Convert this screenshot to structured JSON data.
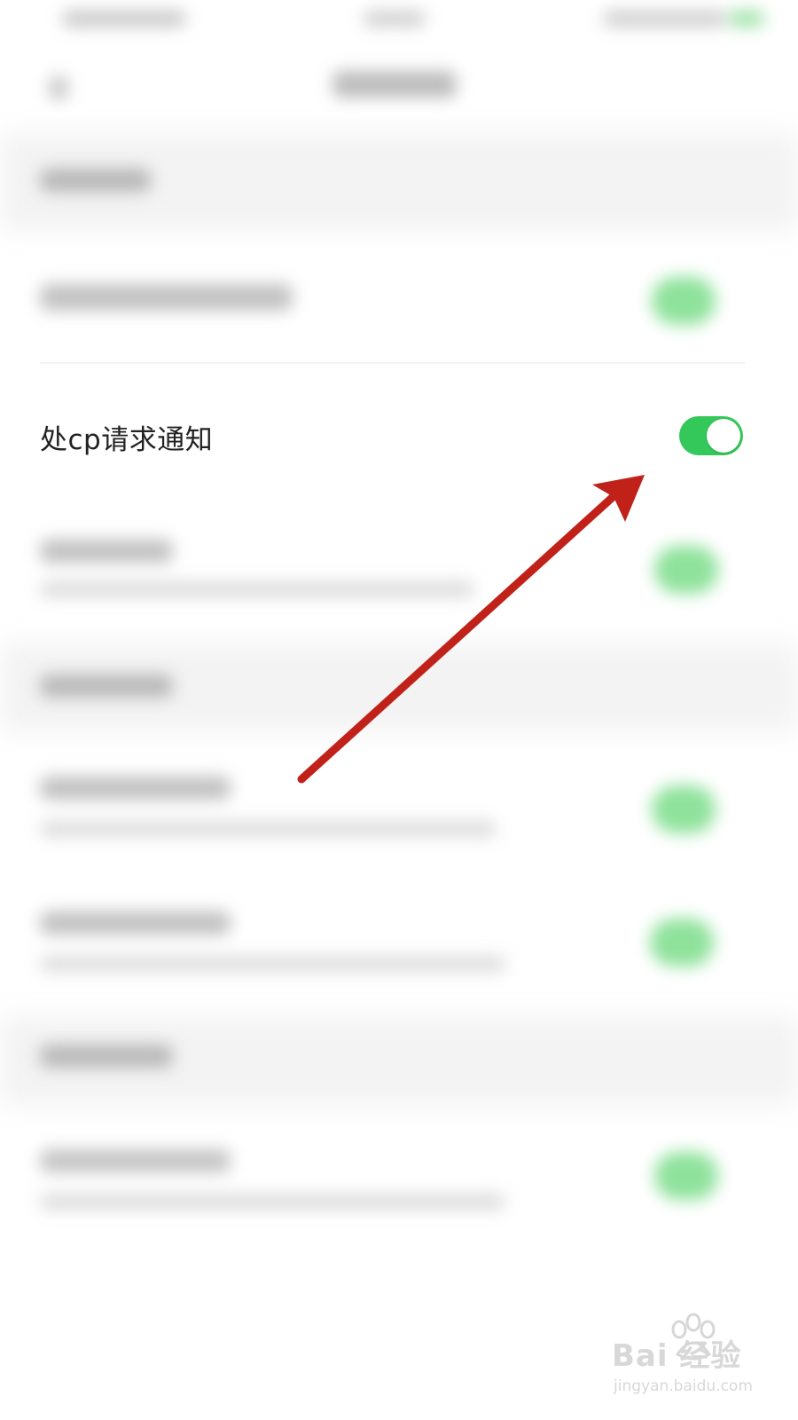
{
  "setting_row": {
    "label": "处cp请求通知",
    "toggle_state": "on"
  },
  "watermark": {
    "brand": "Bai  经验",
    "url": "jingyan.baidu.com"
  },
  "colors": {
    "toggle_on": "#34c759",
    "arrow": "#c0221a",
    "text": "#222222"
  },
  "icons": {
    "back": "back-arrow-icon",
    "annotation": "annotation-arrow-icon",
    "watermark": "paw-icon"
  }
}
